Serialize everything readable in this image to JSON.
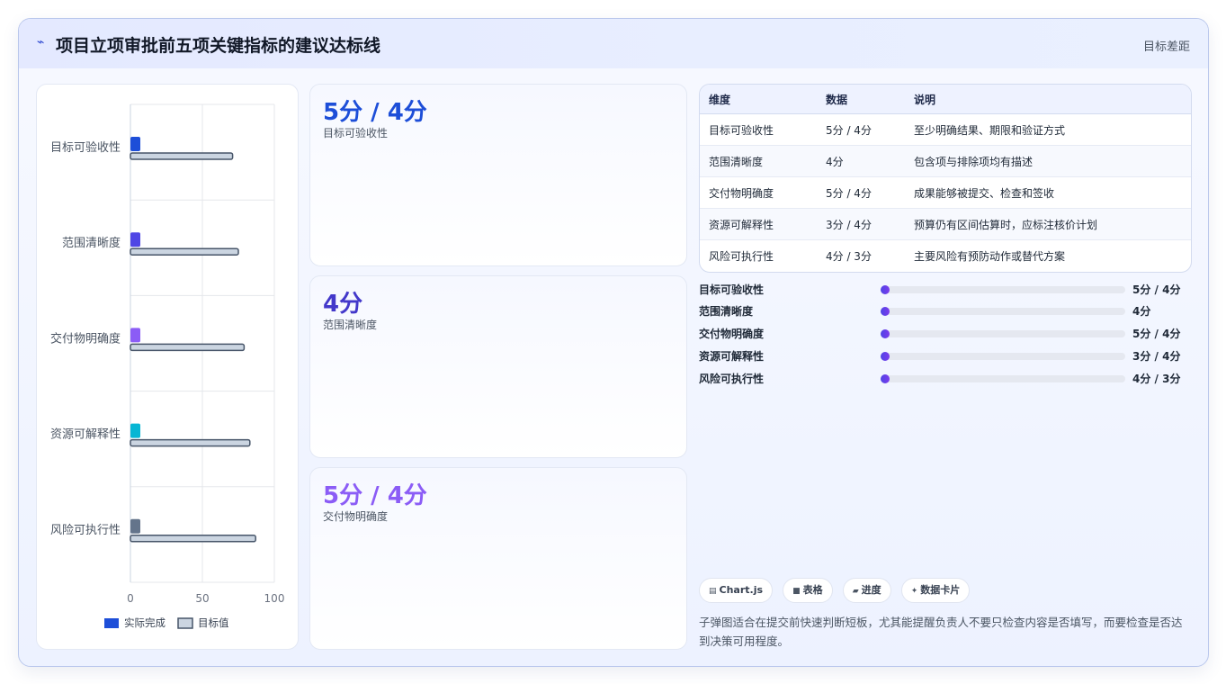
{
  "header": {
    "title": "项目立项审批前五项关键指标的建议达标线",
    "right_label": "目标差距",
    "title_icon": "trend-line-icon"
  },
  "chart_data": {
    "type": "bar",
    "orientation": "horizontal",
    "categories": [
      "目标可验收性",
      "范围清晰度",
      "交付物明确度",
      "资源可解释性",
      "风险可执行性"
    ],
    "series": [
      {
        "name": "实际完成",
        "values": [
          5,
          5,
          5,
          5,
          5
        ],
        "colors": [
          "#1d4ed8",
          "#4f46e5",
          "#8b5cf6",
          "#06b6d4",
          "#64748b"
        ]
      },
      {
        "name": "目标值",
        "values": [
          71,
          75,
          79,
          83,
          87
        ],
        "color": "#cbd5e1",
        "stroke": "#475569"
      }
    ],
    "xlim": [
      0,
      100
    ],
    "xticks": [
      "0",
      "50",
      "100"
    ],
    "grid": true,
    "legend": "bottom"
  },
  "stats": [
    {
      "value": "5分 / 4分",
      "label": "目标可验收性",
      "color": "#1d4ed8"
    },
    {
      "value": "4分",
      "label": "范围清晰度",
      "color": "#4338ca"
    },
    {
      "value": "5分 / 4分",
      "label": "交付物明确度",
      "color": "#8b5cf6"
    }
  ],
  "table": {
    "headers": [
      "维度",
      "数据",
      "说明"
    ],
    "rows": [
      [
        "目标可验收性",
        "5分 / 4分",
        "至少明确结果、期限和验证方式"
      ],
      [
        "范围清晰度",
        "4分",
        "包含项与排除项均有描述"
      ],
      [
        "交付物明确度",
        "5分 / 4分",
        "成果能够被提交、检查和签收"
      ],
      [
        "资源可解释性",
        "3分 / 4分",
        "预算仍有区间估算时，应标注核价计划"
      ],
      [
        "风险可执行性",
        "4分 / 3分",
        "主要风险有预防动作或替代方案"
      ]
    ]
  },
  "progress": [
    {
      "label": "目标可验收性",
      "value": "5分 / 4分",
      "fraction": 0.03
    },
    {
      "label": "范围清晰度",
      "value": "4分",
      "fraction": 0.03
    },
    {
      "label": "交付物明确度",
      "value": "5分 / 4分",
      "fraction": 0.03
    },
    {
      "label": "资源可解释性",
      "value": "3分 / 4分",
      "fraction": 0.03
    },
    {
      "label": "风险可执行性",
      "value": "4分 / 3分",
      "fraction": 0.03
    }
  ],
  "chips": [
    {
      "label": "Chart.js",
      "icon": "chart-icon"
    },
    {
      "label": "表格",
      "icon": "table-icon"
    },
    {
      "label": "进度",
      "icon": "progress-icon"
    },
    {
      "label": "数据卡片",
      "icon": "sparkle-icon"
    }
  ],
  "note": "子弹图适合在提交前快速判断短板，尤其能提醒负责人不要只检查内容是否填写，而要检查是否达到决策可用程度。"
}
